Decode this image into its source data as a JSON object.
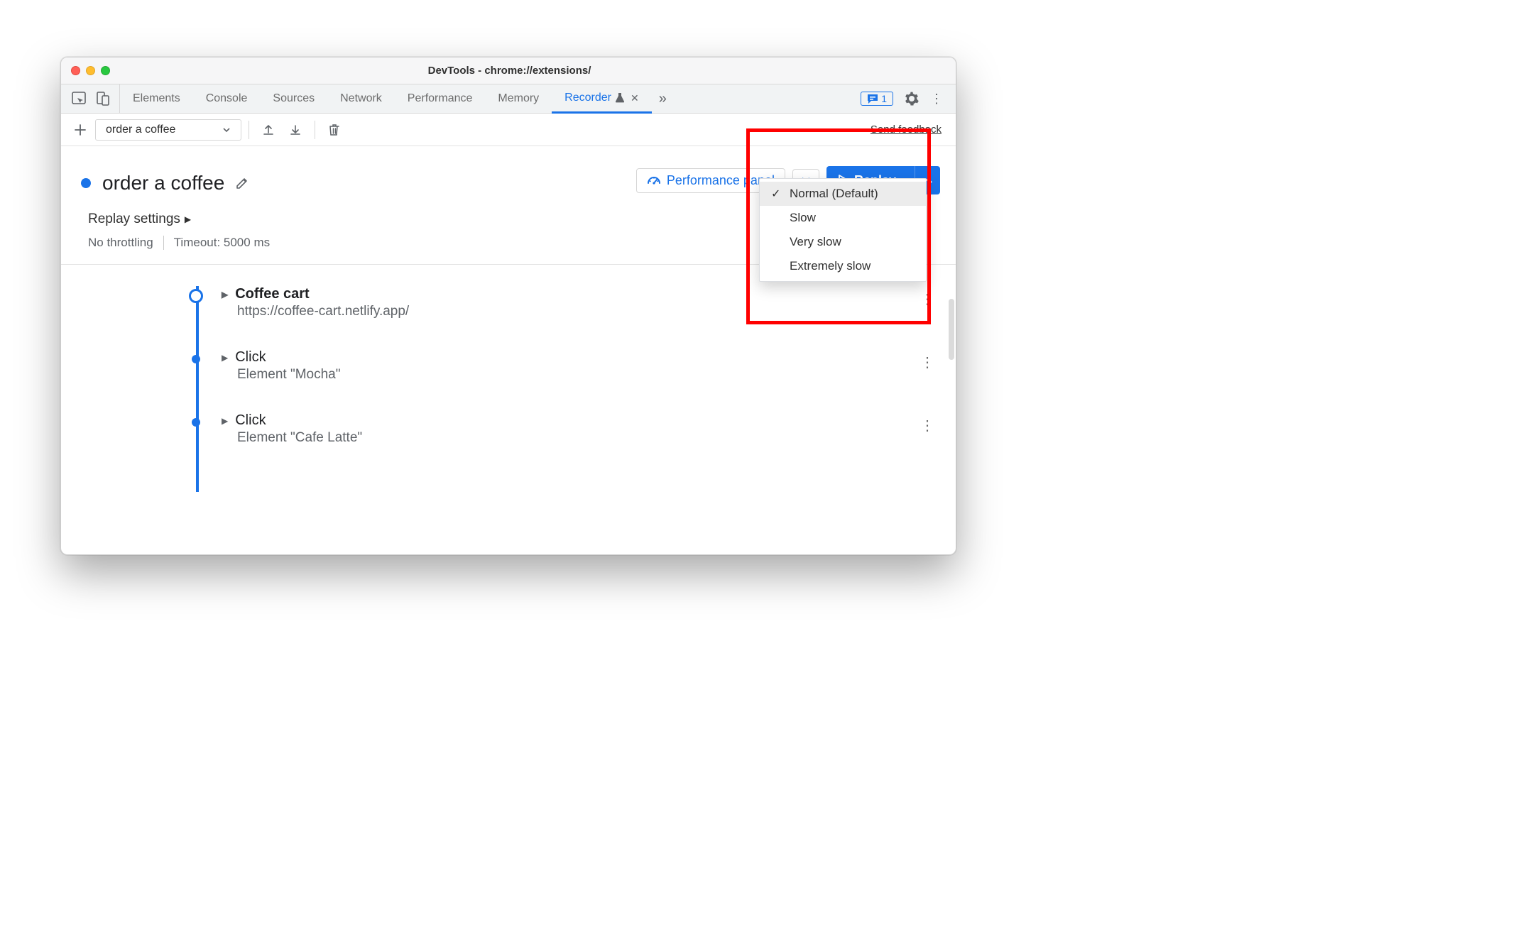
{
  "window": {
    "title": "DevTools - chrome://extensions/"
  },
  "tabs": {
    "list": [
      "Elements",
      "Console",
      "Sources",
      "Network",
      "Performance",
      "Memory"
    ],
    "active_label": "Recorder",
    "issues_count": "1"
  },
  "toolbar": {
    "recording_name": "order a coffee",
    "feedback": "Send feedback"
  },
  "recording": {
    "title": "order a coffee",
    "perf_button": "Performance panel",
    "replay_button": "Replay"
  },
  "dropdown": {
    "items": [
      "Normal (Default)",
      "Slow",
      "Very slow",
      "Extremely slow"
    ],
    "selected_index": 0
  },
  "settings": {
    "heading": "Replay settings",
    "throttling": "No throttling",
    "timeout": "Timeout: 5000 ms"
  },
  "steps": [
    {
      "title": "Coffee cart",
      "subtitle": "https://coffee-cart.netlify.app/",
      "bold": true,
      "open": true
    },
    {
      "title": "Click",
      "subtitle": "Element \"Mocha\"",
      "bold": false,
      "open": false
    },
    {
      "title": "Click",
      "subtitle": "Element \"Cafe Latte\"",
      "bold": false,
      "open": false
    }
  ]
}
